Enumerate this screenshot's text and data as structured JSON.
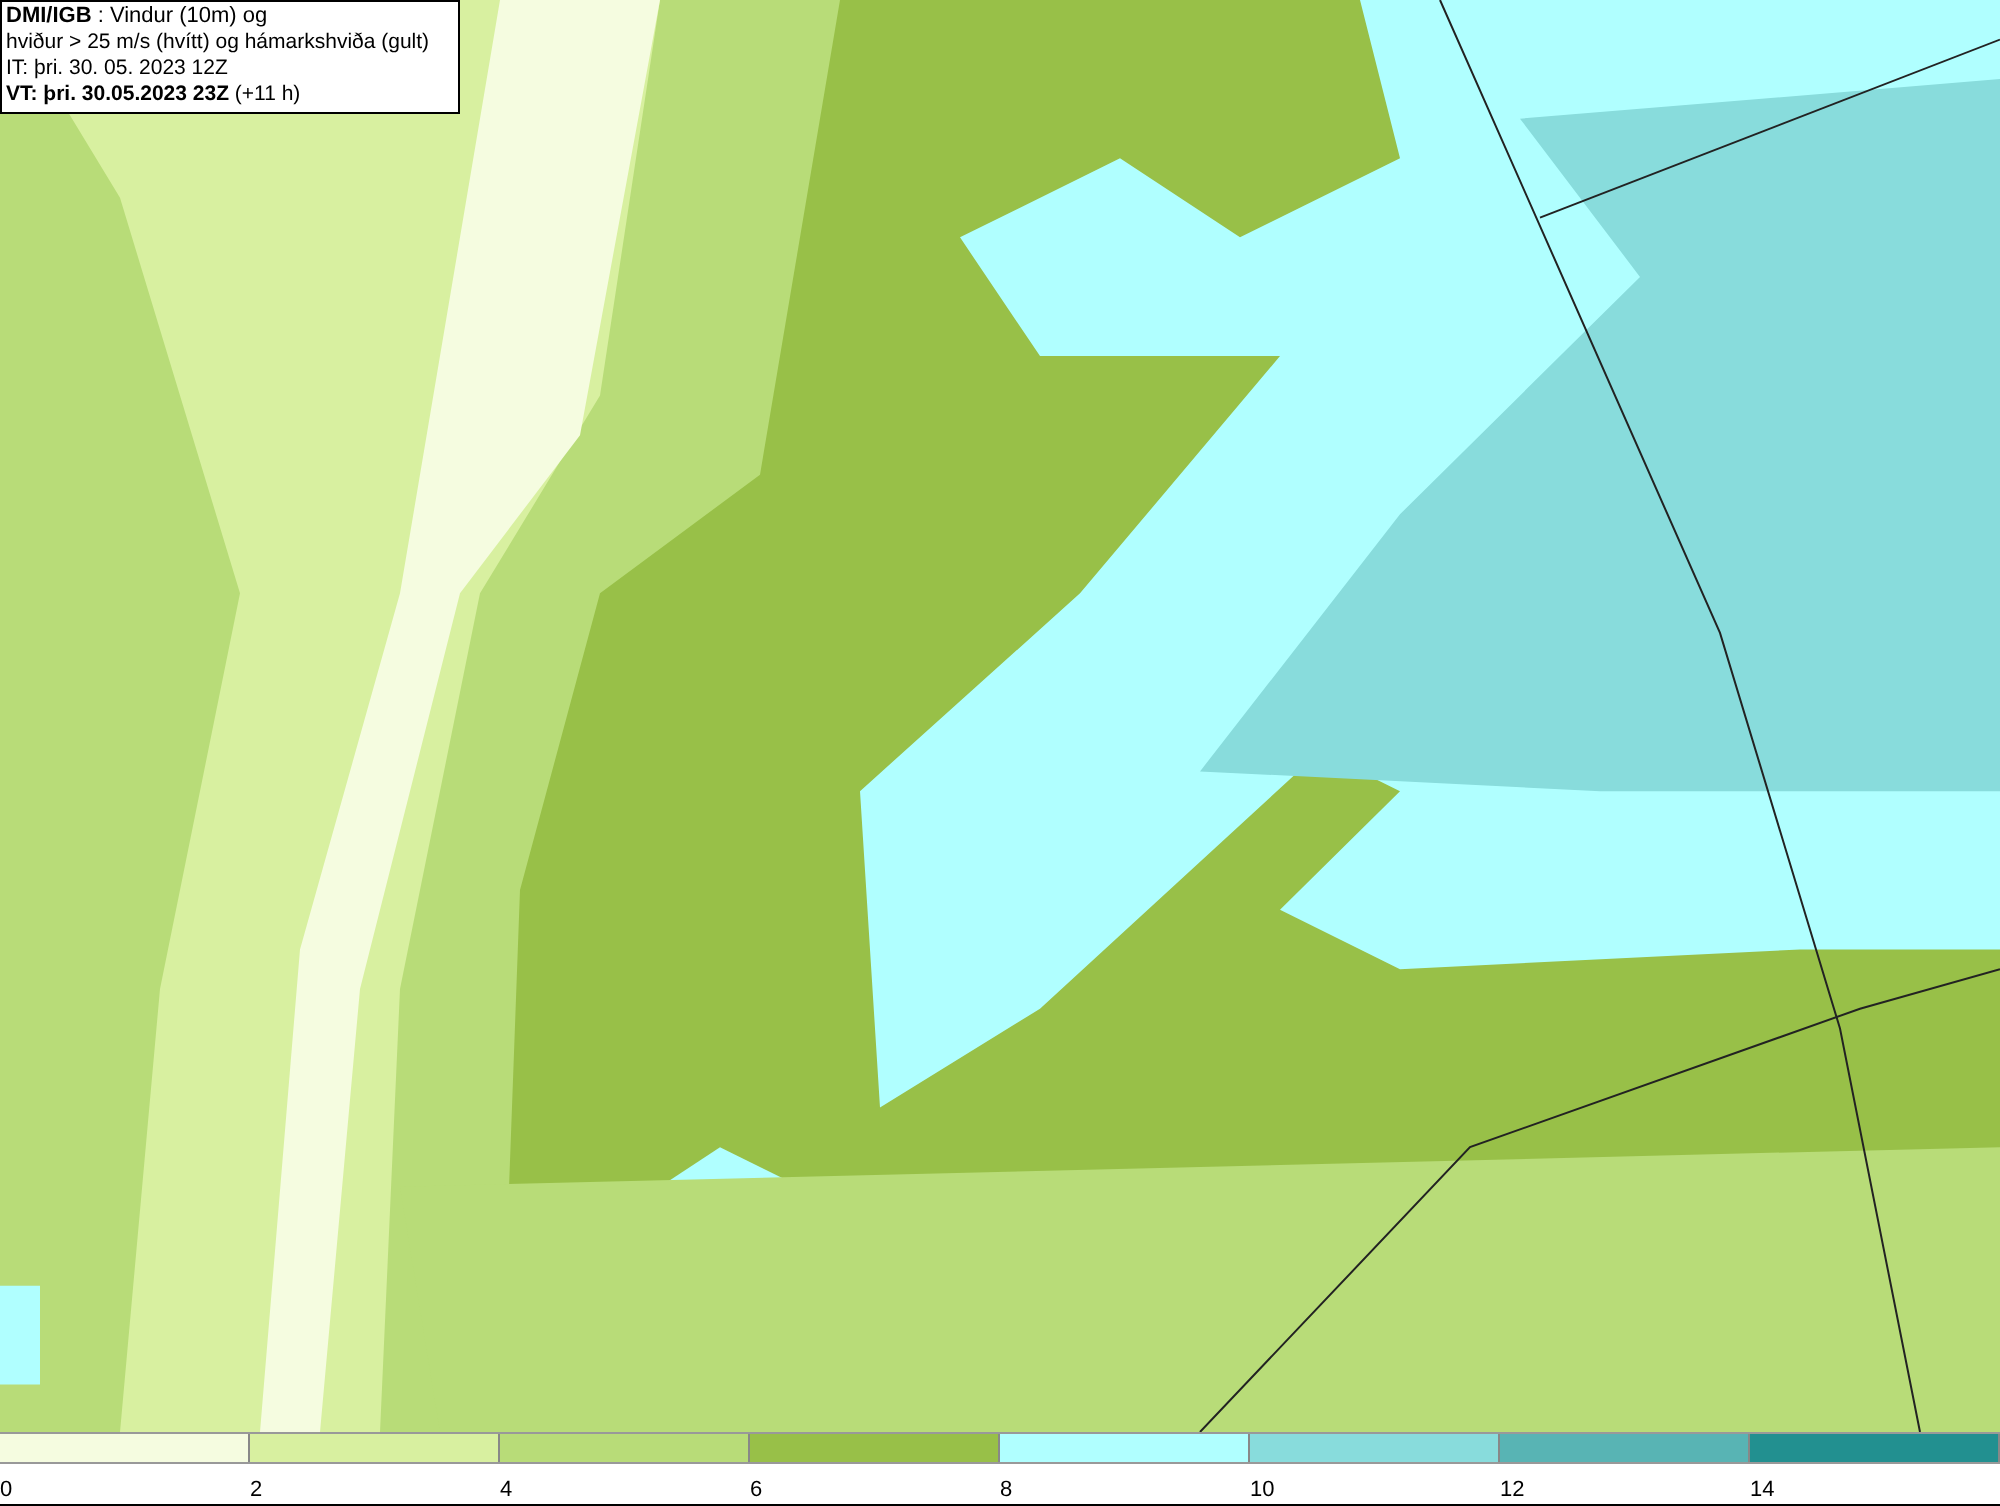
{
  "info_box": {
    "lines": [
      "**DMI/IGB** : Vindur (10m) og",
      "hviður > 25 m/s (hvítt) og hámarkshviða (gult)",
      "IT: þri. 30. 05. 2023 12Z",
      "**VT: þri. 30.05.2023 23Z** (+11 h)"
    ]
  },
  "legend": {
    "bins": [
      {
        "label": "0",
        "color": "#f5fce0"
      },
      {
        "label": "2",
        "color": "#d8f0a0"
      },
      {
        "label": "4",
        "color": "#b8dc78"
      },
      {
        "label": "6",
        "color": "#98c048"
      },
      {
        "label": "8",
        "color": "#b0ffff"
      },
      {
        "label": "10",
        "color": "#88dcdc"
      },
      {
        "label": "12",
        "color": "#58b4b4"
      },
      {
        "label": "14",
        "color": "#229090"
      }
    ]
  }
}
